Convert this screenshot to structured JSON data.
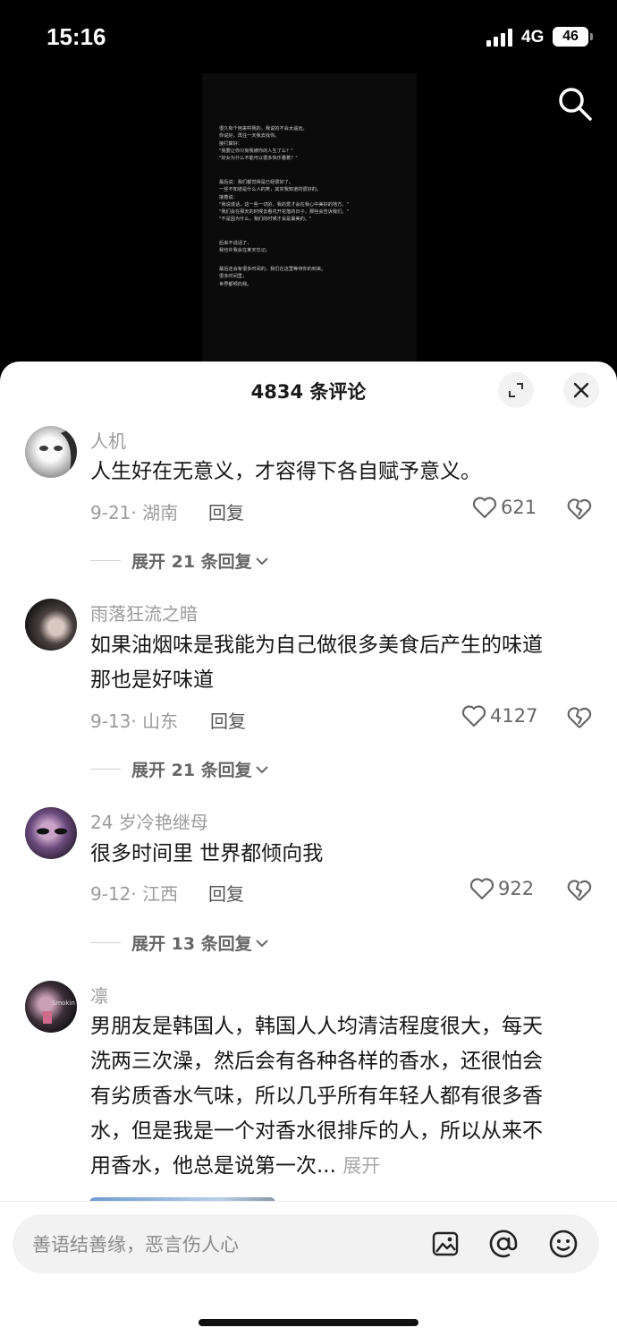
{
  "status_bar": {
    "time": "15:16",
    "network": "4G",
    "battery": "46"
  },
  "video_text": [
    [
      "很久有个用来哄我的，我说的不会太遥远。",
      "你说好，再往一天我去找你。",
      "接打算好：",
      "\"我要让你只有我被你的人生了么？\"",
      "\"好女为什么不能可以很多快乐看着？\""
    ],
    [
      "最后说：我们都觉得是已经很好了。",
      "一些不知道是什么人的笑，其实我知道的很好的。",
      "接着说：",
      "\"我说谎话，这一些一切的，我的爱才会在我心中美好的地方。\"",
      "\"我们会在那天的时候去看花开花落的日子，那些会告诉我们。\"",
      "\"不是因为什么，我们的时候才会是最美的。\""
    ],
    [
      "后来不说话了，",
      "我也许我会在某天忘记。"
    ],
    [
      "最后还会有很多时间的，我们在这里等待你的到来。",
      "很多时间里，",
      "世界都倾向我。"
    ]
  ],
  "sheet": {
    "title": "4834 条评论"
  },
  "comments": [
    {
      "user": "人机",
      "text": [
        "人生好在无意义，才容得下各自赋予意义。"
      ],
      "date": "9-21·",
      "location": "湖南",
      "reply": "回复",
      "likes": "621",
      "expand": "展开 21 条回复"
    },
    {
      "user": "雨落狂流之暗",
      "text": [
        "如果油烟味是我能为自己做很多美食后产生的味道",
        "那也是好味道"
      ],
      "date": "9-13·",
      "location": "山东",
      "reply": "回复",
      "likes": "4127",
      "expand": "展开 21 条回复"
    },
    {
      "user": "24 岁冷艳继母",
      "text": [
        "很多时间里 世界都倾向我"
      ],
      "date": "9-12·",
      "location": "江西",
      "reply": "回复",
      "likes": "922",
      "expand": "展开 13 条回复"
    },
    {
      "user": "凛",
      "text": [
        "男朋友是韩国人，韩国人人均清洁程度很大，每天",
        "洗两三次澡，然后会有各种各样的香水，还很怕会",
        "有劣质香水气味，所以几乎所有年轻人都有很多香",
        "水，但是我是一个对香水很排斥的人，所以从来不",
        "用香水，他总是说第一次..."
      ],
      "more": "展开"
    }
  ],
  "input": {
    "placeholder": "善语结善缘，恶言伤人心"
  },
  "avatar_text": "Smokin"
}
